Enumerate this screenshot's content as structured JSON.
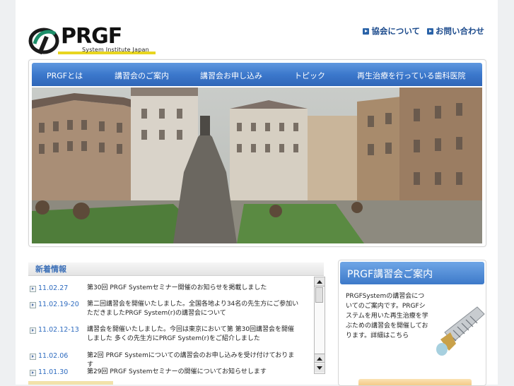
{
  "header": {
    "logo_text": "PRGF",
    "logo_subtitle": "System Institute Japan",
    "links": [
      {
        "label": "協会について",
        "icon": "arrow-square-icon"
      },
      {
        "label": "お問い合わせ",
        "icon": "arrow-square-icon"
      }
    ]
  },
  "nav": {
    "items": [
      {
        "label": "PRGFとは"
      },
      {
        "label": "講習会のご案内"
      },
      {
        "label": "講習会お申し込み"
      },
      {
        "label": "トピック"
      },
      {
        "label": "再生治療を行っている歯科医院"
      }
    ]
  },
  "news": {
    "title": "新着情報",
    "items": [
      {
        "date": "11.02.27",
        "text": "第30回 PRGF Systemセミナー開催のお知らせを掲載しました"
      },
      {
        "date": "11.02.19-20",
        "text": "第二回講習会を開催いたしました。全国各地より34名の先生方にご参加いただきましたPRGF System(r)の講習会について"
      },
      {
        "date": "11.02.12-13",
        "text": "講習会を開催いたしました。今回は東京において第 第30回講習会を開催しました 多くの先生方にPRGF System(r)をご紹介しました"
      },
      {
        "date": "11.02.06",
        "text": "第2回 PRGF Systemについての講習会のお申し込みを受け付けております"
      },
      {
        "date": "11.01.30",
        "text": "第29回 PRGF Systemセミナーの開催についてお知らせします"
      }
    ]
  },
  "side": {
    "title": "PRGF講習会ご案内",
    "text": "PRGFSystemの講習会についてのご案内です。PRGFシステムを用いた再生治療を学ぶための講習会を開催しております。詳細はこちら"
  },
  "colors": {
    "nav_blue": "#3c78cc",
    "link_blue": "#1b4a8c",
    "date_blue": "#2e6bbf",
    "logo_yellow": "#e8d520"
  }
}
